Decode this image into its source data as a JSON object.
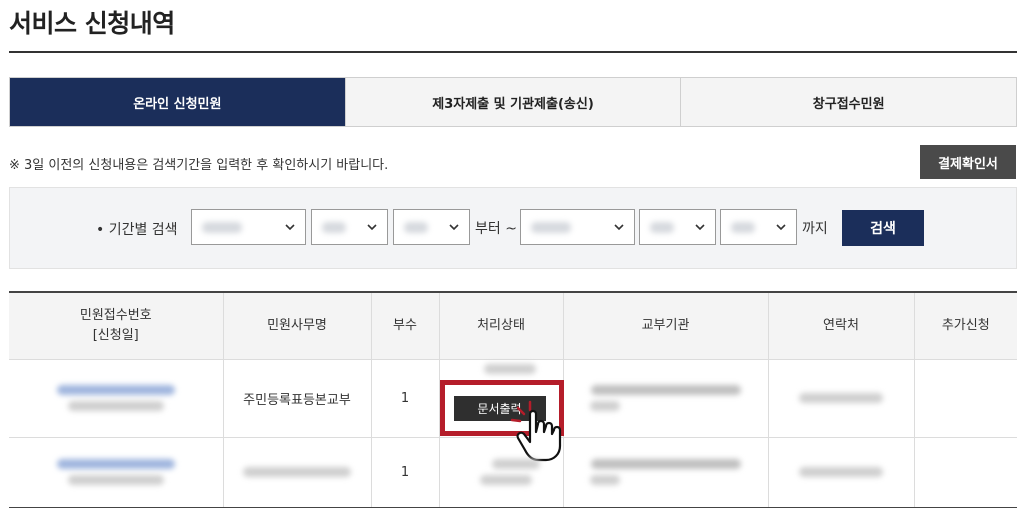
{
  "page": {
    "title": "서비스 신청내역"
  },
  "tabs": [
    {
      "label": "온라인 신청민원",
      "active": true
    },
    {
      "label": "제3자제출 및 기관제출(송신)",
      "active": false
    },
    {
      "label": "창구접수민원",
      "active": false
    }
  ],
  "notice": "※ 3일 이전의 신청내용은 검색기간을 입력한 후 확인하시기 바랍니다.",
  "receipt_button": "결제확인서",
  "search": {
    "label": "• 기간별 검색",
    "from_text": "부터 ~",
    "to_text": "까지",
    "button": "검색"
  },
  "table": {
    "headers": [
      "민원접수번호\n[신청일]",
      "민원사무명",
      "부수",
      "처리상태",
      "교부기관",
      "연락처",
      "추가신청"
    ],
    "rows": [
      {
        "service": "주민등록표등본교부",
        "copies": "1",
        "action_button": "문서출력"
      },
      {
        "service": "",
        "copies": "1",
        "action_button": ""
      }
    ]
  },
  "colors": {
    "accent": "#1b2e5a",
    "highlight": "#b51d2a",
    "dark_button": "#4a4a4a"
  },
  "icons": [
    "chevron-down-icon",
    "pointer-hand-icon"
  ]
}
